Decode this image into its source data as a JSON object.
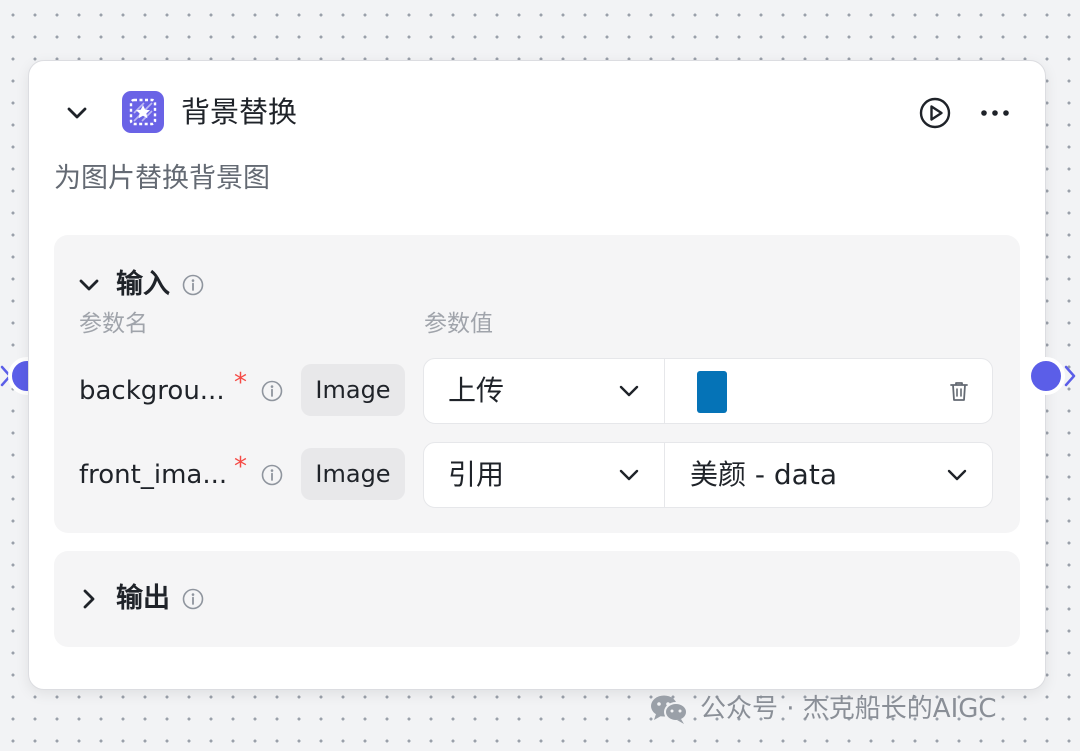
{
  "node": {
    "title": "背景替换",
    "description": "为图片替换背景图",
    "icon": "image-background-icon",
    "accent_color": "#6a63e6"
  },
  "header_actions": {
    "collapse_icon": "chevron-down-icon",
    "run_icon": "play-circle-icon",
    "more_icon": "more-horizontal-icon"
  },
  "input_section": {
    "title": "输入",
    "col_name_header": "参数名",
    "col_value_header": "参数值",
    "params": [
      {
        "name": "backgrou...",
        "required_mark": "*",
        "type": "Image",
        "mode": "上传",
        "thumbnail_color": "#0573b7"
      },
      {
        "name": "front_ima...",
        "required_mark": "*",
        "type": "Image",
        "mode": "引用",
        "reference": "美颜 - data"
      }
    ]
  },
  "output_section": {
    "title": "输出"
  },
  "port_color": "#5b5ee8",
  "watermark": {
    "text": "公众号 · 杰克船长的AIGC"
  }
}
